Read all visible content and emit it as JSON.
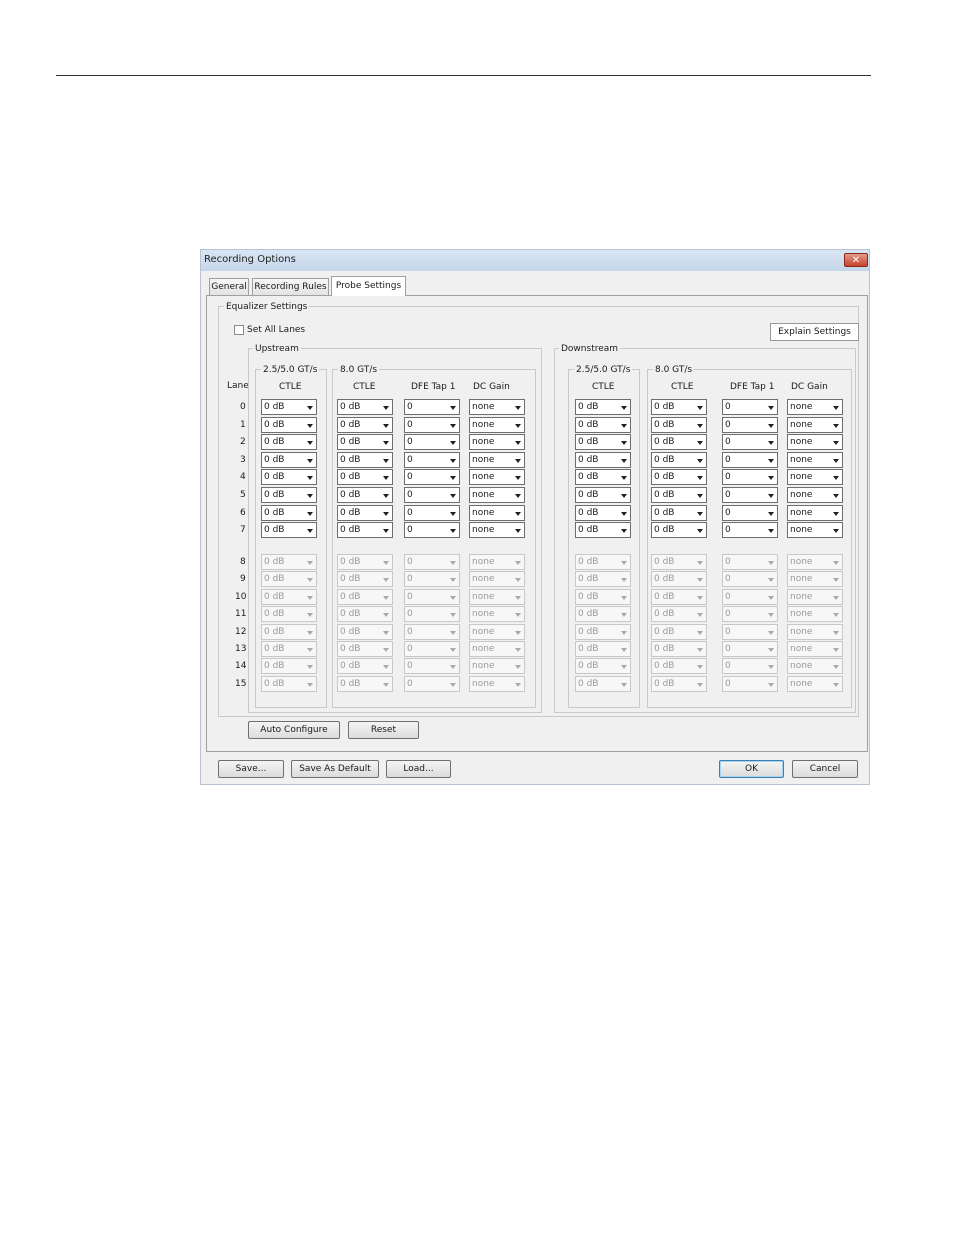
{
  "dialog": {
    "title": "Recording Options",
    "close_glyph": "✕"
  },
  "tabs": [
    {
      "label": "General"
    },
    {
      "label": "Recording Rules"
    },
    {
      "label": "Probe Settings"
    }
  ],
  "equalizer": {
    "group_label": "Equalizer Settings",
    "set_all_lanes_label": "Set All Lanes",
    "explain_button": "Explain Settings",
    "lane_header": "Lane",
    "sections": [
      {
        "label": "Upstream",
        "subgroups": [
          {
            "label": "2.5/5.0 GT/s",
            "columns": [
              "CTLE"
            ]
          },
          {
            "label": "8.0 GT/s",
            "columns": [
              "CTLE",
              "DFE Tap 1",
              "DC Gain"
            ]
          }
        ]
      },
      {
        "label": "Downstream",
        "subgroups": [
          {
            "label": "2.5/5.0 GT/s",
            "columns": [
              "CTLE"
            ]
          },
          {
            "label": "8.0 GT/s",
            "columns": [
              "CTLE",
              "DFE Tap 1",
              "DC Gain"
            ]
          }
        ]
      }
    ],
    "lanes": [
      {
        "lane": "0",
        "enabled": true,
        "values": [
          "0 dB",
          "0 dB",
          "0",
          "none",
          "0 dB",
          "0 dB",
          "0",
          "none"
        ]
      },
      {
        "lane": "1",
        "enabled": true,
        "values": [
          "0 dB",
          "0 dB",
          "0",
          "none",
          "0 dB",
          "0 dB",
          "0",
          "none"
        ]
      },
      {
        "lane": "2",
        "enabled": true,
        "values": [
          "0 dB",
          "0 dB",
          "0",
          "none",
          "0 dB",
          "0 dB",
          "0",
          "none"
        ]
      },
      {
        "lane": "3",
        "enabled": true,
        "values": [
          "0 dB",
          "0 dB",
          "0",
          "none",
          "0 dB",
          "0 dB",
          "0",
          "none"
        ]
      },
      {
        "lane": "4",
        "enabled": true,
        "values": [
          "0 dB",
          "0 dB",
          "0",
          "none",
          "0 dB",
          "0 dB",
          "0",
          "none"
        ]
      },
      {
        "lane": "5",
        "enabled": true,
        "values": [
          "0 dB",
          "0 dB",
          "0",
          "none",
          "0 dB",
          "0 dB",
          "0",
          "none"
        ]
      },
      {
        "lane": "6",
        "enabled": true,
        "values": [
          "0 dB",
          "0 dB",
          "0",
          "none",
          "0 dB",
          "0 dB",
          "0",
          "none"
        ]
      },
      {
        "lane": "7",
        "enabled": true,
        "values": [
          "0 dB",
          "0 dB",
          "0",
          "none",
          "0 dB",
          "0 dB",
          "0",
          "none"
        ]
      },
      {
        "lane": "8",
        "enabled": false,
        "values": [
          "0 dB",
          "0 dB",
          "0",
          "none",
          "0 dB",
          "0 dB",
          "0",
          "none"
        ]
      },
      {
        "lane": "9",
        "enabled": false,
        "values": [
          "0 dB",
          "0 dB",
          "0",
          "none",
          "0 dB",
          "0 dB",
          "0",
          "none"
        ]
      },
      {
        "lane": "10",
        "enabled": false,
        "values": [
          "0 dB",
          "0 dB",
          "0",
          "none",
          "0 dB",
          "0 dB",
          "0",
          "none"
        ]
      },
      {
        "lane": "11",
        "enabled": false,
        "values": [
          "0 dB",
          "0 dB",
          "0",
          "none",
          "0 dB",
          "0 dB",
          "0",
          "none"
        ]
      },
      {
        "lane": "12",
        "enabled": false,
        "values": [
          "0 dB",
          "0 dB",
          "0",
          "none",
          "0 dB",
          "0 dB",
          "0",
          "none"
        ]
      },
      {
        "lane": "13",
        "enabled": false,
        "values": [
          "0 dB",
          "0 dB",
          "0",
          "none",
          "0 dB",
          "0 dB",
          "0",
          "none"
        ]
      },
      {
        "lane": "14",
        "enabled": false,
        "values": [
          "0 dB",
          "0 dB",
          "0",
          "none",
          "0 dB",
          "0 dB",
          "0",
          "none"
        ]
      },
      {
        "lane": "15",
        "enabled": false,
        "values": [
          "0 dB",
          "0 dB",
          "0",
          "none",
          "0 dB",
          "0 dB",
          "0",
          "none"
        ]
      }
    ]
  },
  "panel_buttons": {
    "auto_configure": "Auto Configure",
    "reset": "Reset"
  },
  "footer_buttons": {
    "save": "Save...",
    "save_default": "Save As Default",
    "load": "Load...",
    "ok": "OK",
    "cancel": "Cancel"
  }
}
